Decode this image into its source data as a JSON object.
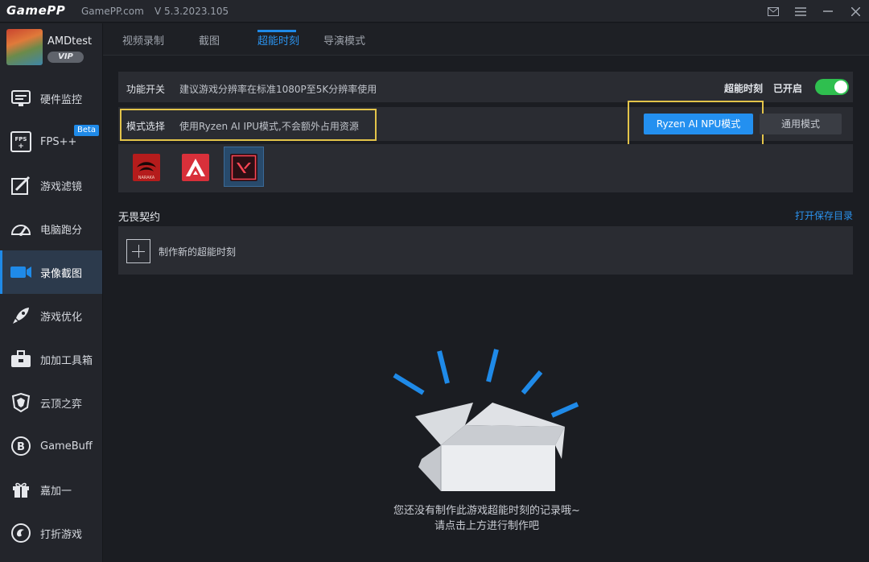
{
  "app": {
    "logo": "GamePP",
    "site": "GamePP.com",
    "version": "V 5.3.2023.105"
  },
  "window_buttons": [
    "mail-icon",
    "menu-icon",
    "minimize-icon",
    "close-icon"
  ],
  "profile": {
    "username": "AMDtest",
    "vip": "VIP"
  },
  "sidebar": {
    "items": [
      {
        "label": "硬件监控",
        "icon": "hardware-monitor-icon"
      },
      {
        "label": "FPS++",
        "icon": "fps-icon",
        "badge": "Beta"
      },
      {
        "label": "游戏滤镜",
        "icon": "filter-icon"
      },
      {
        "label": "电脑跑分",
        "icon": "benchmark-gauge-icon"
      },
      {
        "label": "录像截图",
        "icon": "video-camera-icon",
        "active": true
      },
      {
        "label": "游戏优化",
        "icon": "rocket-icon"
      },
      {
        "label": "加加工具箱",
        "icon": "toolbox-icon"
      },
      {
        "label": "云顶之弈",
        "icon": "tft-icon"
      },
      {
        "label": "GameBuff",
        "icon": "gamebuff-icon"
      },
      {
        "label": "嘉加一",
        "icon": "gift-icon"
      },
      {
        "label": "打折游戏",
        "icon": "discount-icon"
      }
    ]
  },
  "tabs": [
    {
      "label": "视频录制"
    },
    {
      "label": "截图"
    },
    {
      "label": "超能时刻",
      "active": true
    },
    {
      "label": "导演模式"
    }
  ],
  "feature_switch": {
    "label": "功能开关",
    "desc": "建议游戏分辨率在标准1080P至5K分辨率使用",
    "status_label": "超能时刻",
    "status_value": "已开启",
    "enabled": true
  },
  "mode_select": {
    "label": "模式选择",
    "desc": "使用Ryzen AI IPU模式,不会额外占用资源",
    "primary_button": "Ryzen AI NPU模式",
    "secondary_button": "通用模式"
  },
  "games": [
    {
      "icon": "naraka-game-icon",
      "text": "NARAKA"
    },
    {
      "icon": "apex-game-icon"
    },
    {
      "icon": "valorant-game-icon",
      "selected": true
    }
  ],
  "section": {
    "title": "无畏契约",
    "open_dir": "打开保存目录",
    "create_label": "制作新的超能时刻"
  },
  "empty_state": {
    "line1": "您还没有制作此游戏超能时刻的记录哦~",
    "line2": "请点击上方进行制作吧"
  },
  "colors": {
    "accent": "#2390f0",
    "highlight": "#e3c44a",
    "toggle_on": "#2fbf4f",
    "background": "#1b1d22",
    "panel": "#2a2c32"
  }
}
